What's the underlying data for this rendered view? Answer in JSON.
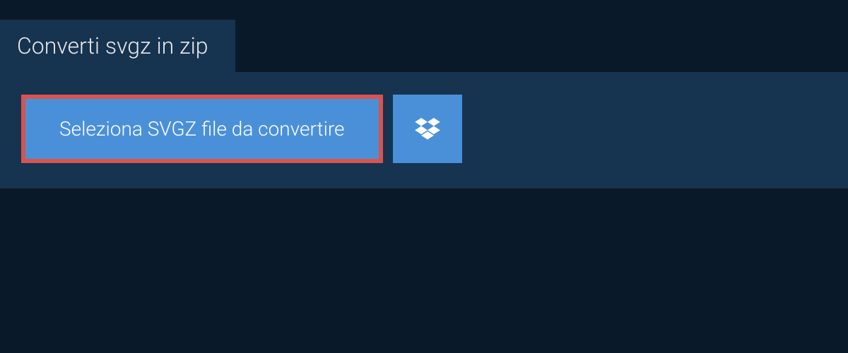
{
  "tab": {
    "title": "Converti svgz in zip"
  },
  "upload": {
    "select_button_label": "Seleziona SVGZ file da convertire"
  },
  "colors": {
    "background": "#0a1929",
    "panel": "#163350",
    "button": "#4a90d9",
    "highlight_border": "#d9534f"
  }
}
